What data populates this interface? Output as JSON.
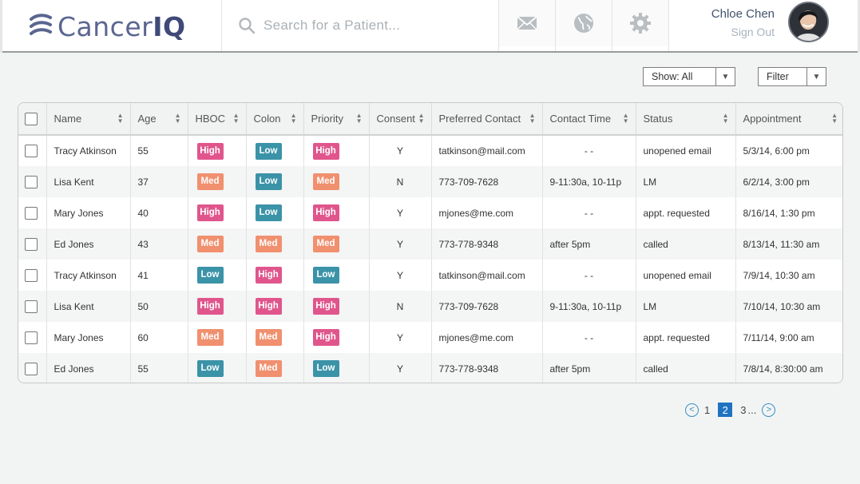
{
  "app": {
    "brand_light": "Cancer",
    "brand_bold": "IQ"
  },
  "search": {
    "placeholder": "Search for a Patient..."
  },
  "header_icons": [
    "mail-icon",
    "globe-icon",
    "gear-icon"
  ],
  "user": {
    "name": "Chloe Chen",
    "signout_label": "Sign Out"
  },
  "filters": {
    "show_label": "Show: All",
    "filter_label": "Filter"
  },
  "table": {
    "columns": [
      "Name",
      "Age",
      "HBOC",
      "Colon",
      "Priority",
      "Consent",
      "Preferred Contact",
      "Contact Time",
      "Status",
      "Appointment"
    ],
    "rows": [
      {
        "name": "Tracy Atkinson",
        "age": "55",
        "hboc": "High",
        "colon": "Low",
        "priority": "High",
        "consent": "Y",
        "contact": "tatkinson@mail.com",
        "time": "- -",
        "status": "unopened email",
        "appt": "5/3/14, 6:00 pm"
      },
      {
        "name": "Lisa Kent",
        "age": "37",
        "hboc": "Med",
        "colon": "Low",
        "priority": "Med",
        "consent": "N",
        "contact": "773-709-7628",
        "time": "9-11:30a, 10-11p",
        "status": "LM",
        "appt": "6/2/14, 3:00 pm"
      },
      {
        "name": "Mary Jones",
        "age": "40",
        "hboc": "High",
        "colon": "Low",
        "priority": "High",
        "consent": "Y",
        "contact": "mjones@me.com",
        "time": "- -",
        "status": "appt. requested",
        "appt": "8/16/14, 1:30 pm"
      },
      {
        "name": "Ed Jones",
        "age": "43",
        "hboc": "Med",
        "colon": "Med",
        "priority": "Med",
        "consent": "Y",
        "contact": "773-778-9348",
        "time": "after 5pm",
        "status": "called",
        "appt": "8/13/14, 11:30 am"
      },
      {
        "name": "Tracy Atkinson",
        "age": "41",
        "hboc": "Low",
        "colon": "High",
        "priority": "Low",
        "consent": "Y",
        "contact": "tatkinson@mail.com",
        "time": "- -",
        "status": "unopened email",
        "appt": "7/9/14, 10:30 am"
      },
      {
        "name": "Lisa Kent",
        "age": "50",
        "hboc": "High",
        "colon": "High",
        "priority": "High",
        "consent": "N",
        "contact": "773-709-7628",
        "time": "9-11:30a, 10-11p",
        "status": "LM",
        "appt": "7/10/14, 10:30 am"
      },
      {
        "name": "Mary Jones",
        "age": "60",
        "hboc": "Med",
        "colon": "Med",
        "priority": "High",
        "consent": "Y",
        "contact": "mjones@me.com",
        "time": "- -",
        "status": "appt. requested",
        "appt": "7/11/14, 9:00 am"
      },
      {
        "name": "Ed Jones",
        "age": "55",
        "hboc": "Low",
        "colon": "Med",
        "priority": "Low",
        "consent": "Y",
        "contact": "773-778-9348",
        "time": "after 5pm",
        "status": "called",
        "appt": "7/8/14, 8:30:00 am"
      }
    ]
  },
  "pagination": {
    "prev": "<",
    "pages": [
      "1",
      "2",
      "3"
    ],
    "current": "2",
    "ellipsis": "...",
    "next": ">"
  },
  "colors": {
    "high": "#e0568c",
    "med": "#f0906f",
    "low": "#3b93a8",
    "brand": "#5a6690",
    "accent": "#1f73c2"
  }
}
